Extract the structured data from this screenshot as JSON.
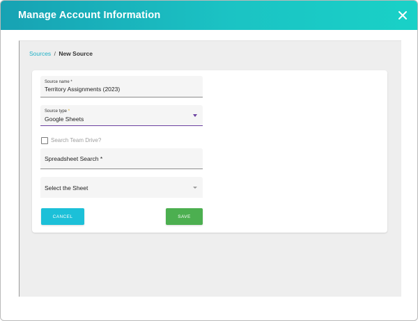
{
  "dialog": {
    "title": "Manage Account Information"
  },
  "breadcrumb": {
    "parent": "Sources",
    "separator": "/",
    "current": "New Source"
  },
  "form": {
    "source_name": {
      "label": "Source name *",
      "value": "Territory Assignments (2023)"
    },
    "source_type": {
      "label": "Source type",
      "required_marker": "*",
      "value": "Google Sheets"
    },
    "search_team_drive": {
      "label": "Search Team Drive?",
      "checked": false
    },
    "spreadsheet_search": {
      "placeholder": "Spreadsheet Search *"
    },
    "sheet_select": {
      "placeholder": "Select the Sheet"
    },
    "cancel_label": "CANCEL",
    "save_label": "SAVE"
  },
  "colors": {
    "header_gradient_start": "#17a2b3",
    "header_gradient_end": "#19d1c7",
    "link": "#1eb0c6",
    "cancel_button": "#1cc0d8",
    "save_button": "#4caf50",
    "focus_underline": "#6a3fa0"
  },
  "icons": {
    "close": "close-icon",
    "dropdown": "caret-down-icon"
  }
}
